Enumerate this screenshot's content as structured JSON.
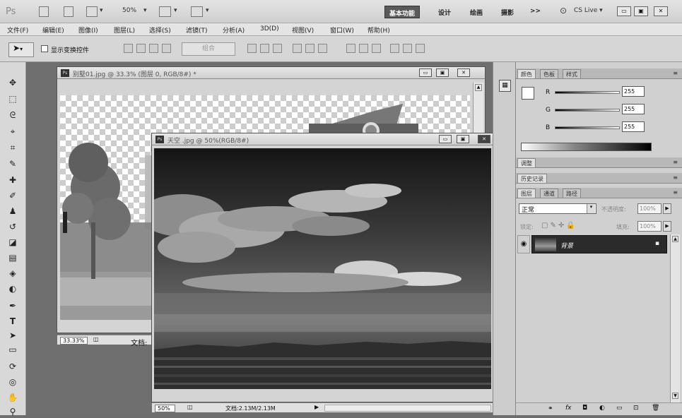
{
  "app": {
    "logo": "Ps",
    "zoom_display": "50%",
    "cs_live": "CS Live"
  },
  "workspaces": [
    {
      "label": "基本功能",
      "active": true
    },
    {
      "label": "设计",
      "active": false
    },
    {
      "label": "绘画",
      "active": false
    },
    {
      "label": "摄影",
      "active": false
    },
    {
      "label": ">>",
      "active": false
    }
  ],
  "menu": [
    "文件(F)",
    "编辑(E)",
    "图像(I)",
    "图层(L)",
    "选择(S)",
    "滤镜(T)",
    "分析(A)",
    "3D(D)",
    "视图(V)",
    "窗口(W)",
    "帮助(H)"
  ],
  "options": {
    "show_transform_label": "显示变换控件",
    "combine_label": "组合"
  },
  "doc_back": {
    "title": "别墅01.jpg @ 33.3% (图层 0, RGB/8#) *",
    "zoom": "33.33%",
    "doc_info": "文档:"
  },
  "doc_front": {
    "title": "天空 .jpg @ 50%(RGB/8#)",
    "zoom": "50%",
    "doc_info": "文档:2.13M/2.13M"
  },
  "color_panel": {
    "tabs": [
      "颜色",
      "色板",
      "样式"
    ],
    "channels": [
      {
        "label": "R",
        "value": "255"
      },
      {
        "label": "G",
        "value": "255"
      },
      {
        "label": "B",
        "value": "255"
      }
    ]
  },
  "adjust_panel": {
    "label": "调整"
  },
  "history_panel": {
    "label": "历史记录"
  },
  "layers_panel": {
    "tabs": [
      "图层",
      "通道",
      "路径"
    ],
    "blend_mode": "正常",
    "opacity_label": "不透明度:",
    "opacity_value": "100%",
    "lock_label": "锁定:",
    "fill_label": "填充:",
    "fill_value": "100%",
    "layer_name": "背景"
  }
}
